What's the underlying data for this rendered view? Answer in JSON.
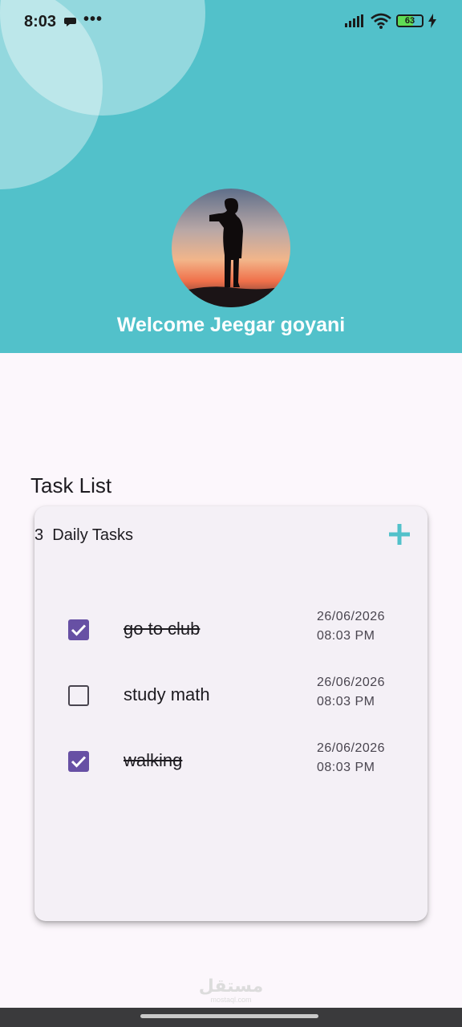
{
  "status_bar": {
    "time": "8:03",
    "battery_level": "63",
    "battery_fraction": 0.63
  },
  "header": {
    "welcome_text": "Welcome Jeegar goyani",
    "background_color": "#52c1ca"
  },
  "section": {
    "title": "Task List"
  },
  "card": {
    "count": "3",
    "label": "Daily Tasks",
    "add_icon": "plus-icon",
    "accent_color": "#52c1ca"
  },
  "tasks": [
    {
      "name": "go to club",
      "done": true,
      "date": "26/06/2026",
      "time": "08:03 PM"
    },
    {
      "name": "study math",
      "done": false,
      "date": "26/06/2026",
      "time": "08:03 PM"
    },
    {
      "name": "walking",
      "done": true,
      "date": "26/06/2026",
      "time": "08:03 PM"
    }
  ],
  "watermark": {
    "logo": "مستقل",
    "site": "mostaql.com"
  },
  "colors": {
    "checkbox_checked": "#6750a4",
    "page_background": "#fcf7fc"
  }
}
